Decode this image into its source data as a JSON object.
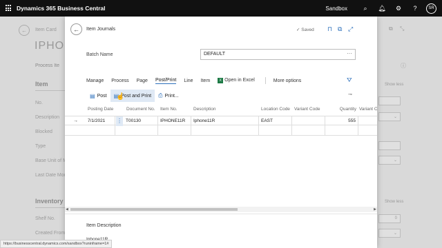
{
  "app": {
    "title": "Dynamics 365 Business Central",
    "environment": "Sandbox",
    "user_initials": "SR",
    "icons": [
      "search-icon",
      "bell-icon",
      "gear-icon",
      "help-icon"
    ]
  },
  "background": {
    "title": "Item Card",
    "big_title": "IPHONE",
    "tabs": "Process   Ite",
    "section_item": "Item",
    "fields": [
      "No.",
      "Description",
      "Blocked",
      "Type",
      "Base Unit of M",
      "Last Date Mod"
    ],
    "section_inventory": "Inventory",
    "inv_fields": [
      "Shelf No.",
      "Created From"
    ],
    "show_less": "Show less",
    "right_value": "0"
  },
  "modal": {
    "title": "Item Journals",
    "saved": "Saved",
    "batch_label": "Batch Name",
    "batch_value": "DEFAULT",
    "batch_more": "···",
    "menu": [
      "Manage",
      "Process",
      "Page",
      "Post/Print",
      "Line",
      "Item"
    ],
    "menu_active": "Post/Print",
    "open_in_excel": "Open in Excel",
    "more_options": "More options",
    "actions": {
      "post": "Post",
      "post_and_print": "Post and Print",
      "print": "Print..."
    },
    "columns": [
      "Posting Date",
      "Document No.",
      "Item No.",
      "Description",
      "Location Code",
      "Variant Code",
      "Quantity",
      "Variant C"
    ],
    "rows": [
      {
        "posting_date": "7/1/2021",
        "document_no": "T00130",
        "item_no": "IPHONE11R",
        "description": "Iphone11R",
        "location_code": "EAST",
        "variant_code": "",
        "quantity": "555",
        "variant_c": ""
      }
    ],
    "item_description_label": "Item Description",
    "item_description_value": "Iphone11R"
  },
  "status_url": "https://businesscentral.dynamics.com/sandbox?runinframe=1#"
}
